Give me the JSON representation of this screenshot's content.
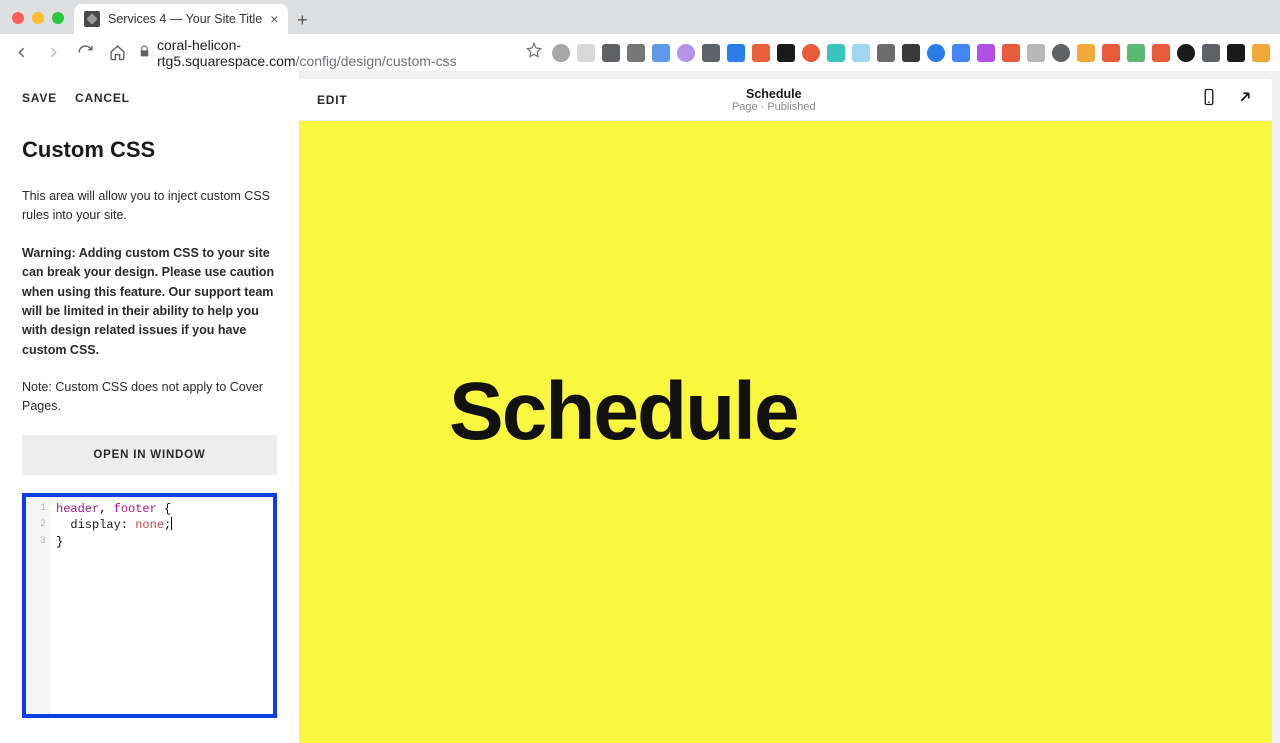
{
  "browser": {
    "tab_title": "Services 4 — Your Site Title",
    "url_domain": "coral-helicon-rtg5.squarespace.com",
    "url_path": "/config/design/custom-css"
  },
  "sidebar": {
    "save_label": "SAVE",
    "cancel_label": "CANCEL",
    "panel_title": "Custom CSS",
    "desc1": "This area will allow you to inject custom CSS rules into your site.",
    "desc2": "Warning: Adding custom CSS to your site can break your design. Please use caution when using this feature. Our support team will be limited in their ability to help you with design related issues if you have custom CSS.",
    "desc3": "Note: Custom CSS does not apply to Cover Pages.",
    "open_window_label": "OPEN IN WINDOW",
    "code": {
      "line1_sel1": "header",
      "line1_comma": ", ",
      "line1_sel2": "footer",
      "line1_brace": " {",
      "line2_indent": "  ",
      "line2_prop": "display",
      "line2_colon": ": ",
      "line2_val": "none",
      "line2_semi": ";",
      "line3": "}"
    },
    "line_numbers": [
      "1",
      "2",
      "3"
    ]
  },
  "preview": {
    "edit_label": "EDIT",
    "title": "Schedule",
    "subtitle": "Page · Published",
    "heading": "Schedule"
  },
  "ext_colors": [
    "#a7a7a7",
    "#d8d8d8",
    "#5f6368",
    "#777",
    "#6098ea",
    "#b494ea",
    "#5f6368",
    "#2b7de9",
    "#e9603e",
    "#1a1a1a",
    "#e85b3a",
    "#3bc4bb",
    "#a0d6ef",
    "#6d6d6d",
    "#3a3a3a",
    "#2b7de9",
    "#4285f4",
    "#b04fe6",
    "#e85b3a",
    "#b8b8b8",
    "#5f6368",
    "#f2a93b",
    "#e85b3a",
    "#5bb974",
    "#e85b3a",
    "#1a1a1a",
    "#5f6368",
    "#1a1a1a",
    "#f2a93b"
  ]
}
